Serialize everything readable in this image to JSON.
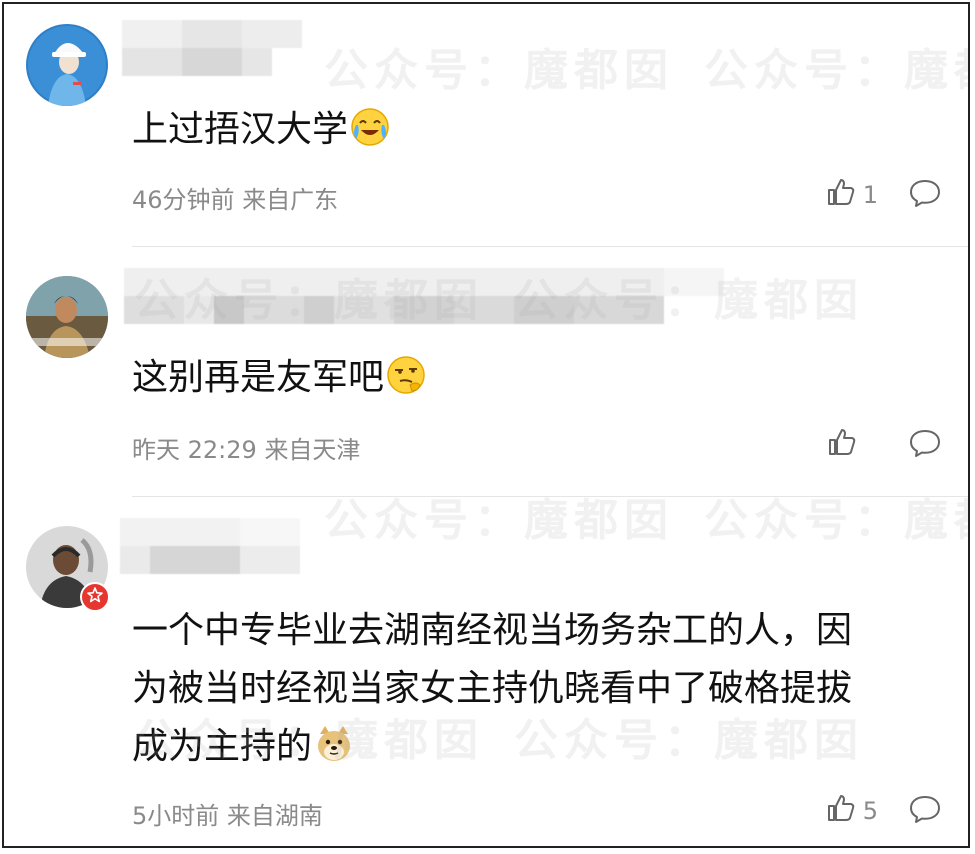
{
  "watermark": {
    "text": "公众号：魔都囡"
  },
  "comments": [
    {
      "content": "上过捂汉大学",
      "emoji": "laughing-tears-emoji",
      "time": "46分钟前",
      "location": "来自广东",
      "likes": "1"
    },
    {
      "content": "这别再是友军吧",
      "emoji": "thinking-smug-emoji",
      "time": "昨天 22:29",
      "location": "来自天津",
      "likes": ""
    },
    {
      "content_lines": [
        "一个中专毕业去湖南经视当场务杂工的人，因",
        "为被当时经视当家女主持仇晓看中了破格提拔",
        "成为主持的"
      ],
      "emoji": "doge-emoji",
      "time": "5小时前",
      "location": "来自湖南",
      "likes": "5"
    }
  ],
  "colors": {
    "meta_text": "#8a8a8a",
    "badge_red": "#e5372f",
    "divider": "#e5e5e5"
  }
}
